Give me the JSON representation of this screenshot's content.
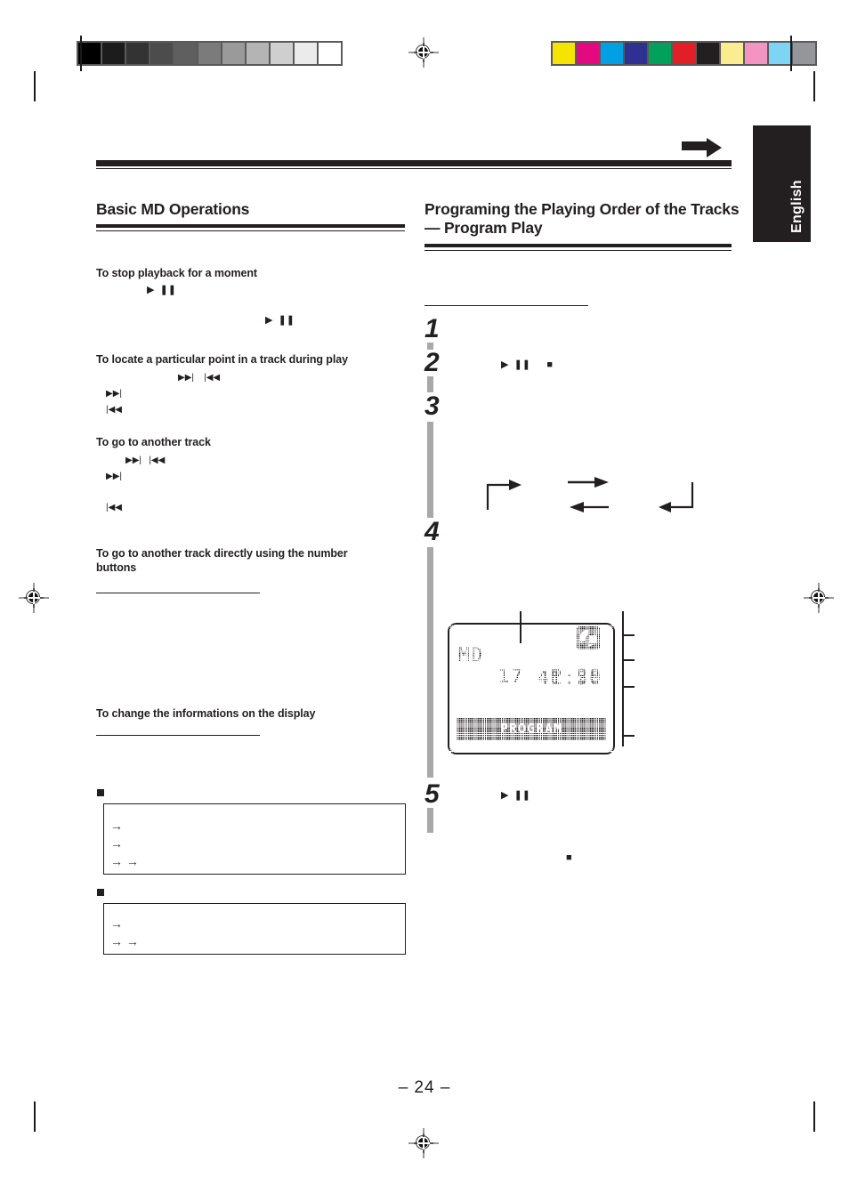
{
  "page": {
    "folio": "– 24 –",
    "language_tab": "English"
  },
  "calibration": {
    "grayscale_patches": [
      "#000000",
      "#1c1c1c",
      "#333333",
      "#4c4c4c",
      "#5f5f5f",
      "#7b7b7b",
      "#9a9a9a",
      "#b4b4b4",
      "#cfcfcf",
      "#ebebeb",
      "#ffffff"
    ],
    "color_patches": [
      "#f5e400",
      "#e5097f",
      "#00a0e3",
      "#2e3192",
      "#00a25b",
      "#e01f26",
      "#231f20",
      "#faed8f",
      "#f494c2",
      "#7fd4f4",
      "#949699"
    ]
  },
  "left_column": {
    "section_title": "Basic MD Operations",
    "subsections": [
      {
        "heading": "To stop playback for a moment",
        "glyph_rows": [
          "▶  ❚❚",
          "▶  ❚❚"
        ]
      },
      {
        "heading": "To locate a particular point in a track during play",
        "glyph_rows": [
          "▶▶|    |◀◀",
          "▶▶|",
          "|◀◀"
        ]
      },
      {
        "heading": "To go to another track",
        "glyph_rows": [
          "▶▶|   |◀◀",
          "▶▶|",
          "|◀◀"
        ]
      },
      {
        "heading": "To go to another track directly using the number buttons",
        "glyph_rows": []
      },
      {
        "heading": "To change the informations on the display",
        "glyph_rows": []
      }
    ],
    "info_boxes": [
      {
        "arrow_rows": [
          "→",
          "→",
          "→          →"
        ]
      },
      {
        "arrow_rows": [
          "→",
          "→          →"
        ]
      }
    ]
  },
  "right_column": {
    "section_title_line1": "Programing the Playing Order of the Tracks",
    "section_title_line2": "— Program Play",
    "steps": [
      {
        "number": "1",
        "glyphs": ""
      },
      {
        "number": "2",
        "glyphs": "▶  ❚❚      ■"
      },
      {
        "number": "3",
        "glyphs": ""
      },
      {
        "number": "4",
        "glyphs": ""
      },
      {
        "number": "5",
        "glyphs": "▶  ❚❚"
      }
    ],
    "trailing_glyph": "■"
  },
  "lcd_display": {
    "source_label": "MD",
    "track_number": "17",
    "program_prefix": "P",
    "program_number": "28",
    "time": "41:50",
    "banner_text": "PROGRAM",
    "disc_icon": "minidisc-icon"
  }
}
